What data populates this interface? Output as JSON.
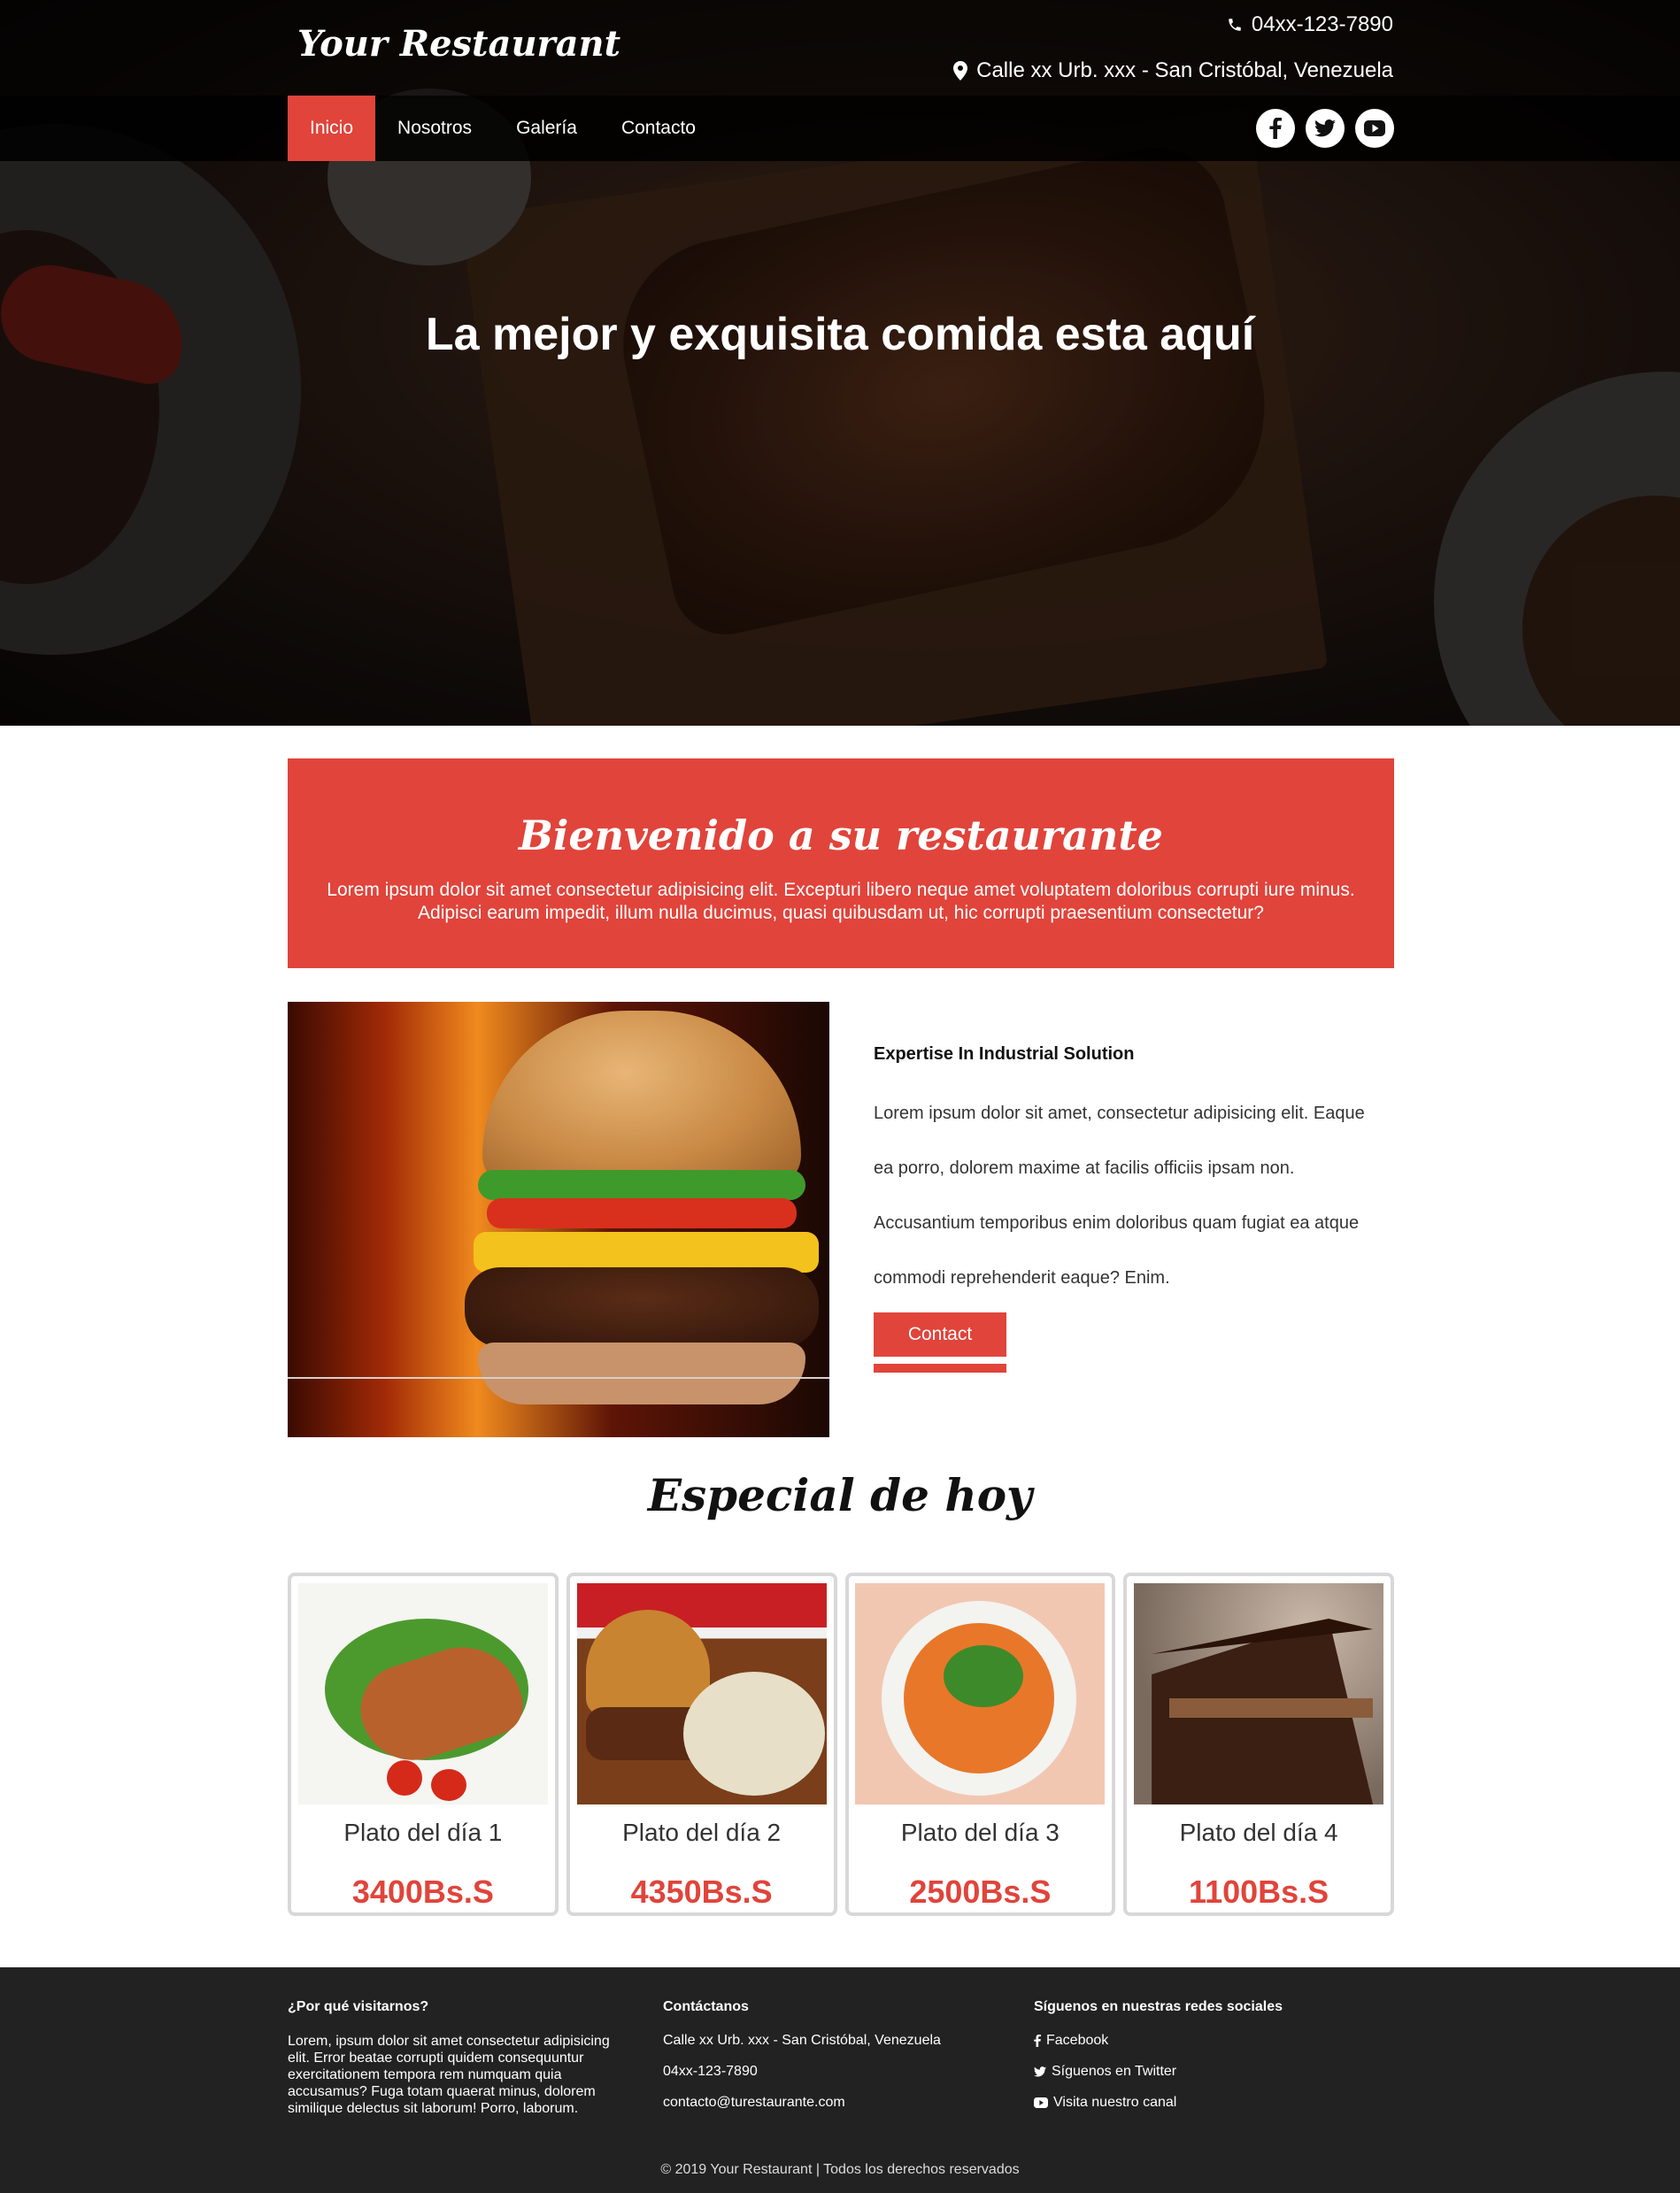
{
  "header": {
    "logo": "Your Restaurant",
    "phone": "04xx-123-7890",
    "address": "Calle xx Urb. xxx - San Cristóbal, Venezuela"
  },
  "nav": {
    "items": [
      {
        "label": "Inicio",
        "active": true
      },
      {
        "label": "Nosotros"
      },
      {
        "label": "Galería"
      },
      {
        "label": "Contacto"
      }
    ],
    "social_icons": [
      "facebook-icon",
      "twitter-icon",
      "youtube-icon"
    ]
  },
  "hero": {
    "title": "La mejor y exquisita comida esta aquí"
  },
  "welcome": {
    "title": "Bienvenido a su restaurante",
    "text": "Lorem ipsum dolor sit amet consectetur adipisicing elit. Excepturi libero neque amet voluptatem doloribus corrupti iure minus. Adipisci earum impedit, illum nulla ducimus, quasi quibusdam ut, hic corrupti praesentium consectetur?"
  },
  "about": {
    "heading": "Expertise In Industrial Solution",
    "text": "Lorem ipsum dolor sit amet, consectetur adipisicing elit. Eaque ea porro, dolorem maxime at facilis officiis ipsam non. Accusantium temporibus enim doloribus quam fugiat ea atque commodi reprehenderit eaque? Enim.",
    "button": "Contact"
  },
  "specials": {
    "title": "Especial de hoy",
    "dishes": [
      {
        "name": "Plato del día 1",
        "price": "3400Bs.S"
      },
      {
        "name": "Plato del día 2",
        "price": "4350Bs.S"
      },
      {
        "name": "Plato del día 3",
        "price": "2500Bs.S"
      },
      {
        "name": "Plato del día 4",
        "price": "1100Bs.S"
      }
    ]
  },
  "footer": {
    "why": {
      "title": "¿Por qué visitarnos?",
      "text": "Lorem, ipsum dolor sit amet consectetur adipisicing elit. Error beatae corrupti quidem consequuntur exercitationem tempora rem numquam quia accusamus? Fuga totam quaerat minus, dolorem similique delectus sit laborum! Porro, laborum."
    },
    "contact": {
      "title": "Contáctanos",
      "address": "Calle xx Urb. xxx - San Cristóbal, Venezuela",
      "phone": "04xx-123-7890",
      "email": "contacto@turestaurante.com"
    },
    "social": {
      "title": "Síguenos en nuestras redes sociales",
      "facebook": "Facebook",
      "twitter": "Síguenos en Twitter",
      "youtube": "Visita nuestro canal"
    },
    "copyright": "© 2019 Your Restaurant | Todos los derechos reservados"
  },
  "colors": {
    "accent": "#e0443b",
    "footer_bg": "#222222"
  }
}
